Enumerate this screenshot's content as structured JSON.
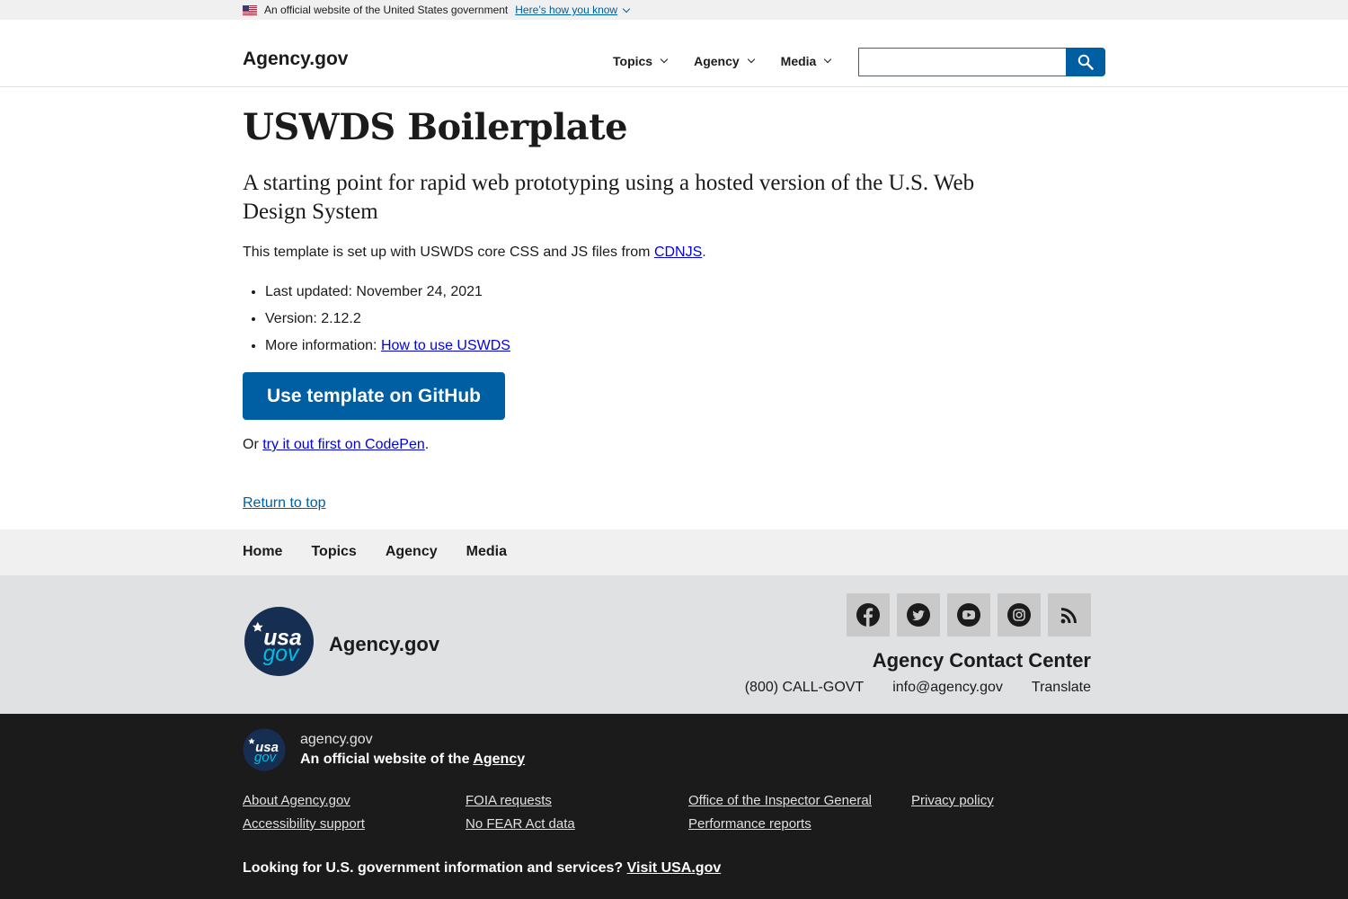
{
  "banner": {
    "text": "An official website of the United States government",
    "link": "Here’s how you know"
  },
  "header": {
    "logo": "Agency.gov",
    "nav": [
      "Topics",
      "Agency",
      "Media"
    ],
    "search_value": "",
    "accent": "#005ea2"
  },
  "main": {
    "title": "USWDS Boilerplate",
    "lead": "A starting point for rapid web prototyping using a hosted version of the U.S. Web Design System",
    "intro_prefix": "This template is set up with USWDS core CSS and JS files from ",
    "intro_link": "CDNJS",
    "intro_suffix": ".",
    "list": {
      "updated": "Last updated: November 24, 2021",
      "version": "Version: 2.12.2",
      "more_prefix": "More information: ",
      "more_link": "How to use USWDS"
    },
    "cta": "Use template on GitHub",
    "or_prefix": "Or ",
    "or_link": "try it out first on CodePen",
    "or_suffix": ".",
    "return_top": "Return to top"
  },
  "footer_nav": [
    "Home",
    "Topics",
    "Agency",
    "Media"
  ],
  "footer_secondary": {
    "agency": "Agency.gov",
    "social_icons": [
      "facebook-icon",
      "twitter-icon",
      "youtube-icon",
      "instagram-icon",
      "rss-icon"
    ],
    "contact_heading": "Agency Contact Center",
    "phone": "(800) CALL-GOVT",
    "email": "info@agency.gov",
    "translate": "Translate"
  },
  "identifier": {
    "domain": "agency.gov",
    "desc_prefix": "An official website of the ",
    "desc_link": "Agency",
    "links": [
      "About Agency.gov",
      "FOIA requests",
      "Office of the Inspector General",
      "Privacy policy",
      "Accessibility support",
      "No FEAR Act data",
      "Performance reports"
    ],
    "usa_prefix": "Looking for U.S. government information and services? ",
    "usa_link": "Visit USA.gov"
  }
}
